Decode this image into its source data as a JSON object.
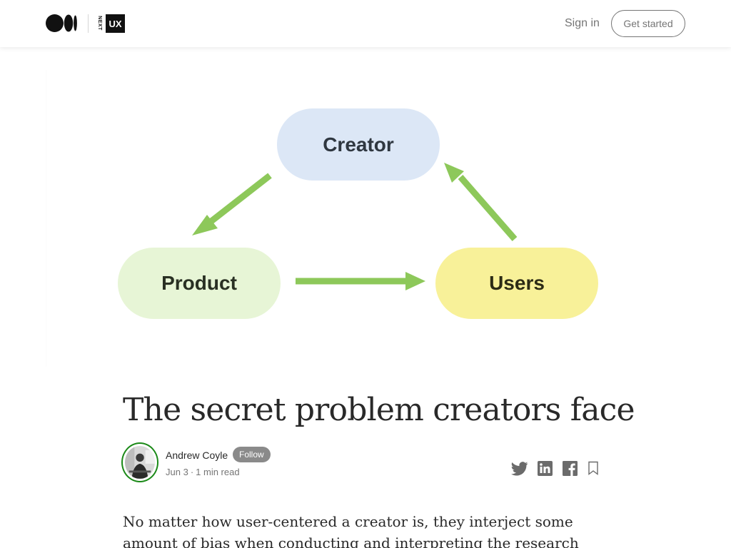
{
  "header": {
    "publication_small": "NEXT",
    "publication_big": "UX",
    "sign_in": "Sign in",
    "get_started": "Get started"
  },
  "diagram": {
    "creator": "Creator",
    "product": "Product",
    "users": "Users",
    "arrow_color": "#8dc85a"
  },
  "article": {
    "title": "The secret problem creators face",
    "author": "Andrew Coyle",
    "follow": "Follow",
    "date": "Jun 3",
    "dot": "·",
    "read_time": "1 min read",
    "body": "No matter how user-centered a creator is, they interject some amount of bias when conducting and interpreting the research they use to inform"
  },
  "share": {
    "icons": [
      "twitter-icon",
      "linkedin-icon",
      "facebook-icon",
      "bookmark-icon"
    ]
  }
}
